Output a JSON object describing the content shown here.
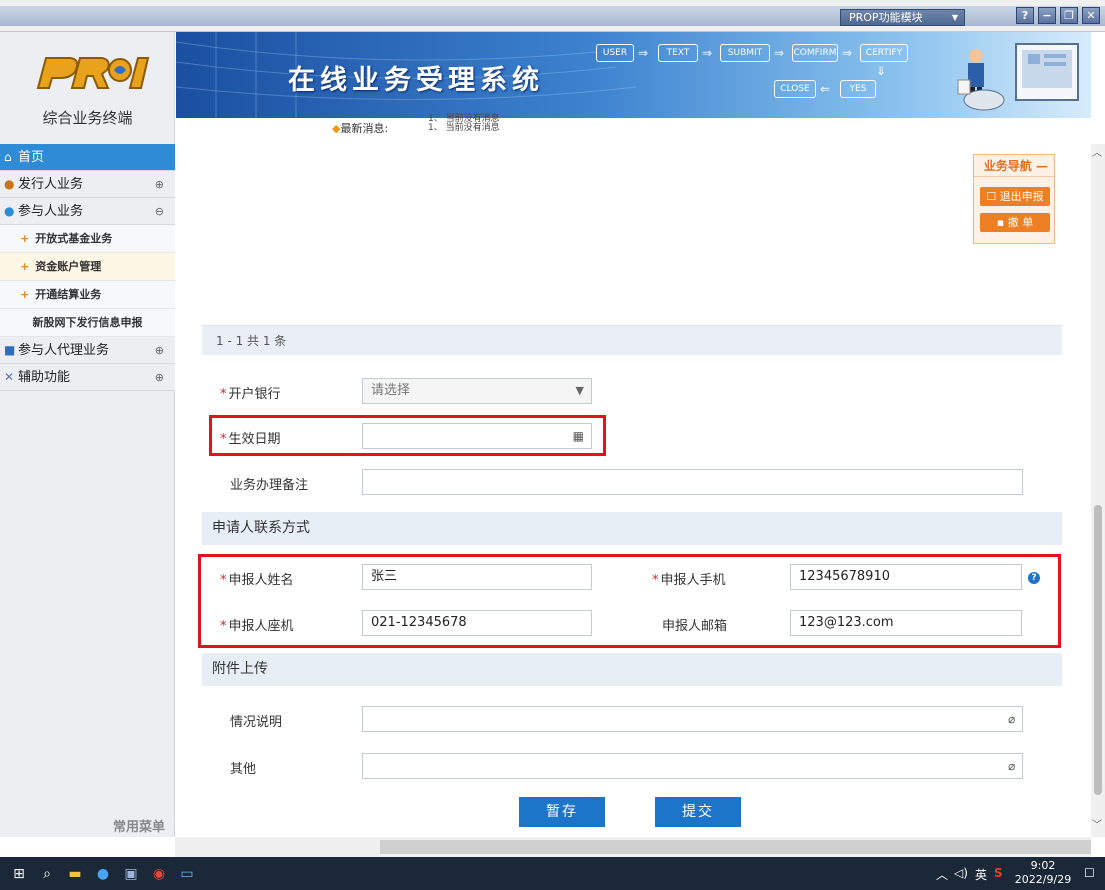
{
  "titlebar": {
    "module_select": "PROP功能模块",
    "buttons": [
      "?",
      "−",
      "❐",
      "✕"
    ]
  },
  "logo": {
    "caption": "综合业务终端"
  },
  "banner": {
    "title": "在线业务受理系统",
    "flow": [
      "USER",
      "TEXT",
      "SUBMIT",
      "COMFIRM",
      "CERTIFY",
      "CLOSE",
      "YES"
    ]
  },
  "news": {
    "label": "最新消息:",
    "items": [
      "1、 当前没有消息",
      "1、 当前没有消息"
    ]
  },
  "sidebar": {
    "home": "首页",
    "issuer": "发行人业务",
    "participant": "参与人业务",
    "sub_items": [
      "开放式基金业务",
      "资金账户管理",
      "开通结算业务",
      "新股网下发行信息申报"
    ],
    "agent": "参与人代理业务",
    "aux": "辅助功能",
    "footer": "常用菜单"
  },
  "grid": {
    "pager": "1 - 1  共 1 条"
  },
  "biz_nav": {
    "title": "业务导航",
    "exit": "退出申报",
    "cancel": "撤    单"
  },
  "form": {
    "bank_label": "开户银行",
    "bank_value": "请选择",
    "date_label": "生效日期",
    "date_value": "",
    "remark_label": "业务办理备注",
    "remark_value": ""
  },
  "contact": {
    "section": "申请人联系方式",
    "name_label": "申报人姓名",
    "name_value": "张三",
    "mobile_label": "申报人手机",
    "mobile_value": "12345678910",
    "phone_label": "申报人座机",
    "phone_value": "021-12345678",
    "email_label": "申报人邮箱",
    "email_value": "123@123.com"
  },
  "attach": {
    "section": "附件上传",
    "desc_label": "情况说明",
    "other_label": "其他"
  },
  "actions": {
    "save": "暂存",
    "submit": "提交"
  },
  "taskbar": {
    "time": "9:02",
    "date": "2022/9/29",
    "lang": "英"
  }
}
